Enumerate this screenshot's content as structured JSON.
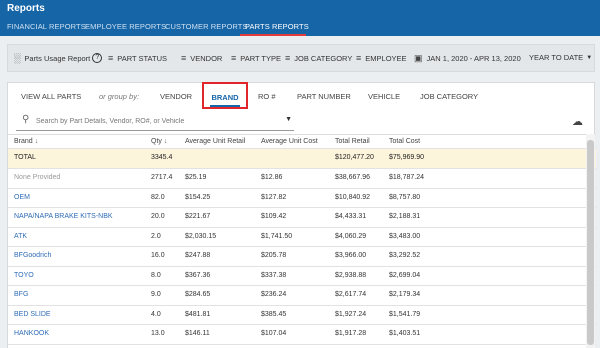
{
  "app": {
    "title": "Reports"
  },
  "report_tabs": [
    {
      "label": "FINANCIAL REPORTS",
      "active": false
    },
    {
      "label": "EMPLOYEE REPORTS",
      "active": false
    },
    {
      "label": "CUSTOMER REPORTS",
      "active": false
    },
    {
      "label": "PARTS REPORTS",
      "active": true
    }
  ],
  "filters": {
    "report_name": "Parts Usage Report",
    "part_status": "PART STATUS",
    "vendor": "VENDOR",
    "part_type": "PART TYPE",
    "job_category": "JOB CATEGORY",
    "employee": "EMPLOYEE",
    "date_range": "JAN 1, 2020 - APR 13, 2020",
    "period": "YEAR TO DATE"
  },
  "grouping": {
    "view_all": "VIEW ALL PARTS",
    "or_group_by": "or group by:",
    "options": [
      "VENDOR",
      "BRAND",
      "RO #",
      "PART NUMBER",
      "VEHICLE",
      "JOB CATEGORY"
    ],
    "selected": "BRAND"
  },
  "search": {
    "placeholder": "Search by Part Details, Vendor, RO#, or Vehicle",
    "value": ""
  },
  "table": {
    "columns": [
      "Brand",
      "Qty",
      "Average Unit Retail",
      "Average Unit Cost",
      "Total Retail",
      "Total Cost"
    ],
    "total": {
      "label": "TOTAL",
      "qty": "3345.4",
      "avg_retail": "",
      "avg_cost": "",
      "total_retail": "$120,477.20",
      "total_cost": "$75,969.90"
    },
    "rows": [
      {
        "brand": "None Provided",
        "qty": "2717.4",
        "avg_retail": "$25.19",
        "avg_cost": "$12.86",
        "total_retail": "$38,667.96",
        "total_cost": "$18,787.24"
      },
      {
        "brand": "OEM",
        "qty": "82.0",
        "avg_retail": "$154.25",
        "avg_cost": "$127.82",
        "total_retail": "$10,840.92",
        "total_cost": "$8,757.80"
      },
      {
        "brand": "NAPA/NAPA BRAKE KITS-NBK",
        "qty": "20.0",
        "avg_retail": "$221.67",
        "avg_cost": "$109.42",
        "total_retail": "$4,433.31",
        "total_cost": "$2,188.31"
      },
      {
        "brand": "ATK",
        "qty": "2.0",
        "avg_retail": "$2,030.15",
        "avg_cost": "$1,741.50",
        "total_retail": "$4,060.29",
        "total_cost": "$3,483.00"
      },
      {
        "brand": "BFGoodrich",
        "qty": "16.0",
        "avg_retail": "$247.88",
        "avg_cost": "$205.78",
        "total_retail": "$3,966.00",
        "total_cost": "$3,292.52"
      },
      {
        "brand": "TOYO",
        "qty": "8.0",
        "avg_retail": "$367.36",
        "avg_cost": "$337.38",
        "total_retail": "$2,938.88",
        "total_cost": "$2,699.04"
      },
      {
        "brand": "BFG",
        "qty": "9.0",
        "avg_retail": "$284.65",
        "avg_cost": "$236.24",
        "total_retail": "$2,617.74",
        "total_cost": "$2,179.34"
      },
      {
        "brand": "BED SLIDE",
        "qty": "4.0",
        "avg_retail": "$481.81",
        "avg_cost": "$385.45",
        "total_retail": "$1,927.24",
        "total_cost": "$1,541.79"
      },
      {
        "brand": "HANKOOK",
        "qty": "13.0",
        "avg_retail": "$146.11",
        "avg_cost": "$107.04",
        "total_retail": "$1,917.28",
        "total_cost": "$1,403.51"
      }
    ]
  },
  "colors": {
    "header_blue": "#1565a7",
    "active_tab_red": "#e23b3b",
    "highlight_box": "#e0262b",
    "total_row": "#fdf4dc",
    "link_blue": "#2f6cb5"
  }
}
